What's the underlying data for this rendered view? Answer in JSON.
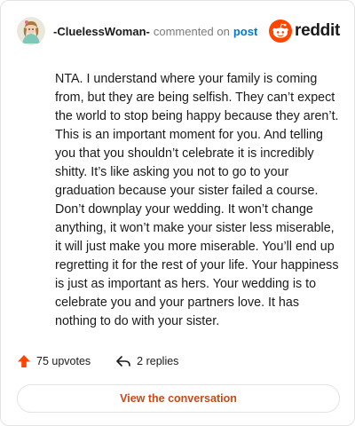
{
  "comment": {
    "username": "-CluelessWoman-",
    "action_text": "commented on",
    "post_link_text": "post",
    "body": "NTA. I understand where your family is coming from, but they are being selfish. They can’t expect the world to stop being happy because they aren’t. This is an important moment for you. And telling you that you shouldn’t celebrate it is incredibly shitty. It’s like asking you not to go to your graduation because your sister failed a course. Don’t downplay your wedding. It won’t change anything, it won’t make your sister less miserable, it will just make you more miserable. You’ll end up regretting it for the rest of your life. Your happiness is just as important as hers. Your wedding is to celebrate you and your partners love. It has nothing to do with your sister."
  },
  "brand": {
    "wordmark": "reddit",
    "icon": "reddit-logo-icon",
    "accent": "#ff4500"
  },
  "stats": {
    "upvotes": "75 upvotes",
    "replies": "2 replies",
    "upvote_icon": "upvote-arrow-icon",
    "reply_icon": "reply-arrow-icon"
  },
  "cta": {
    "label": "View the conversation"
  },
  "colors": {
    "link": "#0079d3",
    "cta_text": "#c74a16",
    "muted": "#7c7c7c"
  }
}
